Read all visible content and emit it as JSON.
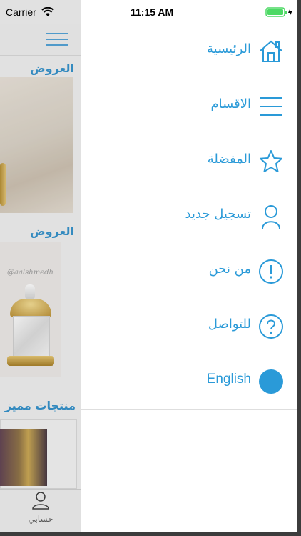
{
  "status_bar": {
    "carrier": "Carrier",
    "time": "11:15 AM",
    "battery_color": "#4cd964"
  },
  "background_app": {
    "sections": [
      {
        "title": "العروض"
      },
      {
        "title": "العروض"
      },
      {
        "title": "منتجات مميز"
      }
    ],
    "image_watermark": "@aalshmedh",
    "tab_bar": {
      "profile_label": "حسابي",
      "profile_icon": "person-icon"
    }
  },
  "drawer": {
    "accent_color": "#2a9ad8",
    "items": [
      {
        "label": "الرئيسية",
        "icon": "home-icon"
      },
      {
        "label": "الاقسام",
        "icon": "list-icon"
      },
      {
        "label": "المفضلة",
        "icon": "star-icon"
      },
      {
        "label": "تسجيل جديد",
        "icon": "user-icon"
      },
      {
        "label": "من نحن",
        "icon": "info-icon"
      },
      {
        "label": "للتواصل",
        "icon": "question-icon"
      },
      {
        "label": "English",
        "icon": "language-dot-icon"
      }
    ]
  }
}
